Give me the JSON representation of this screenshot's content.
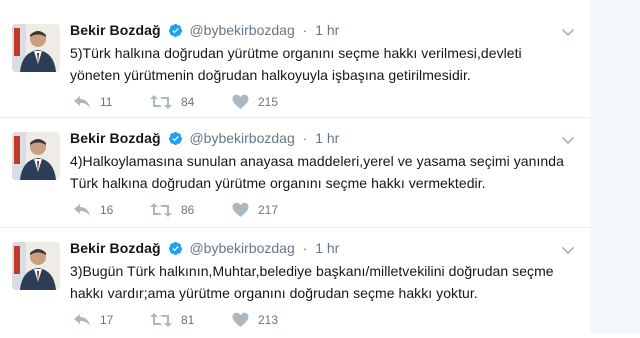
{
  "tweets": [
    {
      "author": "Bekir Bozdağ",
      "handle": "@bybekirbozdag",
      "separator": "·",
      "time": "1 hr",
      "text": "5)Türk halkına doğrudan yürütme organını seçme hakkı verilmesi,devleti yöneten yürütmenin doğrudan halkoyuyla işbaşına getirilmesidir.",
      "replies": "11",
      "retweets": "84",
      "likes": "215"
    },
    {
      "author": "Bekir Bozdağ",
      "handle": "@bybekirbozdag",
      "separator": "·",
      "time": "1 hr",
      "text": "4)Halkoylamasına sunulan anayasa maddeleri,yerel ve yasama seçimi yanında Türk halkına doğrudan yürütme organını seçme hakkı vermektedir.",
      "replies": "16",
      "retweets": "86",
      "likes": "217"
    },
    {
      "author": "Bekir Bozdağ",
      "handle": "@bybekirbozdag",
      "separator": "·",
      "time": "1 hr",
      "text": "3)Bugün Türk halkının,Muhtar,belediye başkanı/milletvekilini doğrudan seçme hakkı vardır;ama yürütme organını doğrudan seçme hakkı yoktur.",
      "replies": "17",
      "retweets": "81",
      "likes": "213"
    }
  ],
  "icons": {
    "verified": "verified-badge-icon",
    "caret": "chevron-down-icon",
    "reply": "reply-icon",
    "retweet": "retweet-icon",
    "like": "heart-icon"
  },
  "colors": {
    "verified": "#1da1f2",
    "text": "#14171a",
    "muted": "#657786",
    "action_icon": "#aab8c2",
    "divider": "#e6ecf0"
  }
}
